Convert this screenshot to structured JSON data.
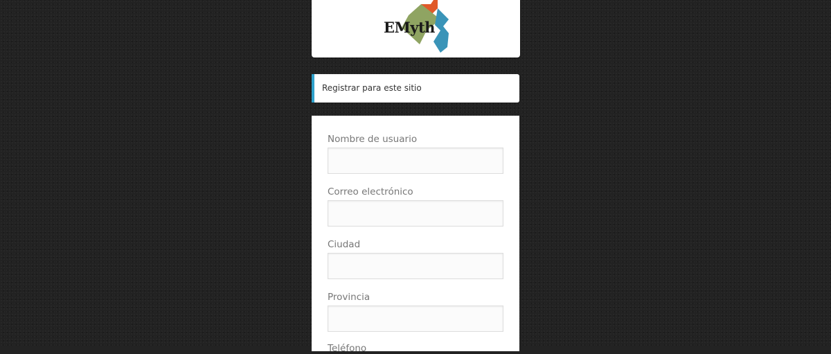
{
  "logo": {
    "text": "EMyth",
    "colors": {
      "green": "#8fa462",
      "orange": "#e05a2a",
      "blue": "#3a94b8"
    }
  },
  "message": {
    "text": "Registrar para este sitio",
    "accent_color": "#2ea2cc"
  },
  "form": {
    "fields": [
      {
        "label": "Nombre de usuario",
        "value": ""
      },
      {
        "label": "Correo electrónico",
        "value": ""
      },
      {
        "label": "Ciudad",
        "value": ""
      },
      {
        "label": "Provincia",
        "value": ""
      },
      {
        "label": "Teléfono",
        "value": ""
      }
    ]
  }
}
